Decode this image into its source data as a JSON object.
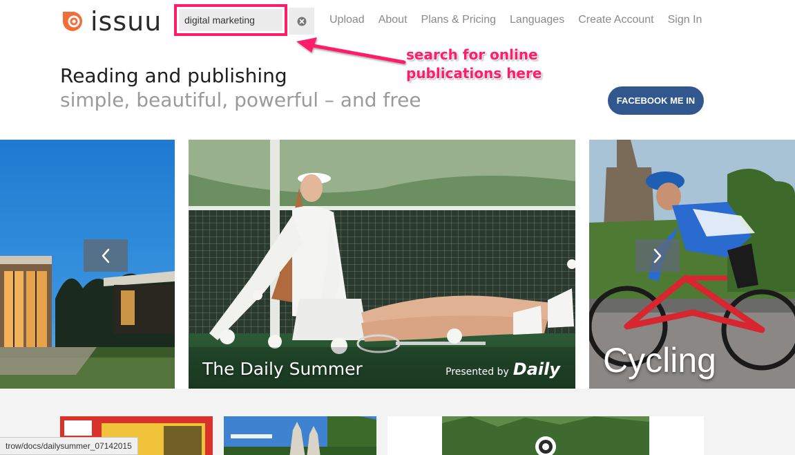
{
  "brand": {
    "name": "issuu",
    "accent": "#f36d38"
  },
  "search": {
    "value": "digital marketing",
    "highlight_color": "#ff1d6b"
  },
  "nav": {
    "items": [
      {
        "label": "Upload"
      },
      {
        "label": "About"
      },
      {
        "label": "Plans & Pricing"
      },
      {
        "label": "Languages"
      },
      {
        "label": "Create Account"
      },
      {
        "label": "Sign In"
      }
    ]
  },
  "annotation": {
    "line1": "search for online",
    "line2": "publications here",
    "color": "#ff1d6b"
  },
  "hero": {
    "title": "Reading and publishing",
    "subtitle": "simple, beautiful, powerful – and free",
    "facebook_button": "FACEBOOK ME IN",
    "facebook_color": "#30588f"
  },
  "carousel": {
    "center": {
      "caption": "The Daily Summer",
      "presented_by": "Presented by",
      "presenter": "Daily"
    },
    "right": {
      "caption": "Cycling"
    },
    "prev_icon": "chevron-left-icon",
    "next_icon": "chevron-right-icon"
  },
  "status_bar": {
    "url": "trow/docs/dailysummer_07142015"
  }
}
